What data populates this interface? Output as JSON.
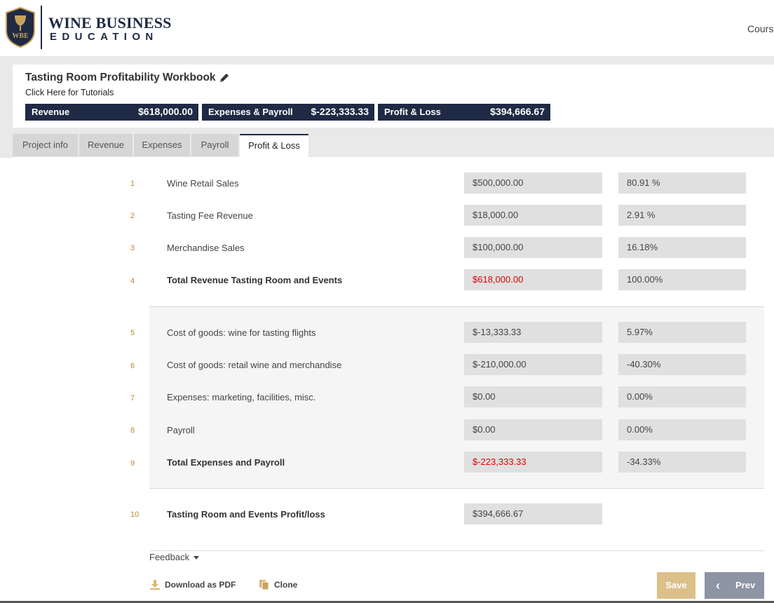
{
  "header": {
    "brand_line1": "WINE BUSINESS",
    "brand_line2": "EDUCATION",
    "logo_monogram": "WBE",
    "nav_courses": "Courses"
  },
  "workbook": {
    "title": "Tasting Room Profitability Workbook",
    "tutorial_link": "Click Here for Tutorials",
    "summary": [
      {
        "label": "Revenue",
        "value": "$618,000.00"
      },
      {
        "label": "Expenses & Payroll",
        "value": "$-223,333.33"
      },
      {
        "label": "Profit & Loss",
        "value": "$394,666.67"
      }
    ]
  },
  "tabs": [
    {
      "label": "Project info"
    },
    {
      "label": "Revenue"
    },
    {
      "label": "Expenses"
    },
    {
      "label": "Payroll"
    },
    {
      "label": "Profit & Loss",
      "active": true
    }
  ],
  "rows": [
    {
      "num": "1",
      "label": "Wine Retail Sales",
      "amount": "$500,000.00",
      "percent": "80.91 %"
    },
    {
      "num": "2",
      "label": "Tasting Fee Revenue",
      "amount": "$18,000.00",
      "percent": "2.91 %"
    },
    {
      "num": "3",
      "label": "Merchandise Sales",
      "amount": "$100,000.00",
      "percent": "16.18%"
    },
    {
      "num": "4",
      "label": "Total Revenue Tasting Room and Events",
      "amount": "$618,000.00",
      "percent": "100.00%"
    },
    {
      "num": "5",
      "label": "Cost of goods: wine for tasting flights",
      "amount": "$-13,333.33",
      "percent": "5.97%"
    },
    {
      "num": "6",
      "label": "Cost of goods: retail wine and merchandise",
      "amount": "$-210,000.00",
      "percent": "-40.30%"
    },
    {
      "num": "7",
      "label": "Expenses: marketing, facilities, misc.",
      "amount": "$0.00",
      "percent": "0.00%"
    },
    {
      "num": "8",
      "label": "Payroll",
      "amount": "$0.00",
      "percent": "0.00%"
    },
    {
      "num": "9",
      "label": "Total Expenses and Payroll",
      "amount": "$-223,333.33",
      "percent": "-34.33%"
    },
    {
      "num": "10",
      "label": "Tasting Room and Events Profit/loss",
      "amount": "$394,666.67"
    }
  ],
  "footer": {
    "feedback": "Feedback",
    "download_pdf": "Download as PDF",
    "clone": "Clone",
    "save": "Save",
    "prev": "Prev"
  },
  "colors": {
    "navy": "#1f2a44",
    "row_number": "#c4862f",
    "total_red": "#e00000",
    "save_button": "#dcc08a",
    "prev_button": "#8d94a4"
  }
}
